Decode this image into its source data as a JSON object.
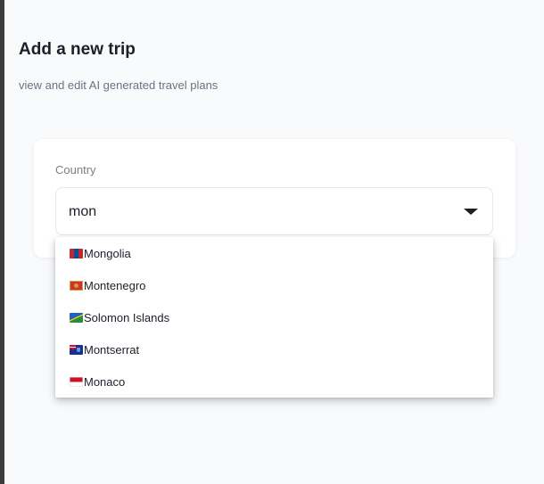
{
  "header": {
    "title": "Add a new trip",
    "subtitle": "view and edit AI generated travel plans"
  },
  "form": {
    "country_label": "Country",
    "country_value": "mon"
  },
  "dropdown": {
    "options": [
      {
        "label": "Mongolia",
        "flag": "flag-mn-icon"
      },
      {
        "label": "Montenegro",
        "flag": "flag-me-icon"
      },
      {
        "label": "Solomon Islands",
        "flag": "flag-sb-icon"
      },
      {
        "label": "Montserrat",
        "flag": "flag-ms-icon"
      },
      {
        "label": "Monaco",
        "flag": "flag-mc-icon"
      }
    ]
  },
  "colors": {
    "background": "#f9fafc",
    "text": "#1c1f2a",
    "muted": "#6b7280"
  }
}
